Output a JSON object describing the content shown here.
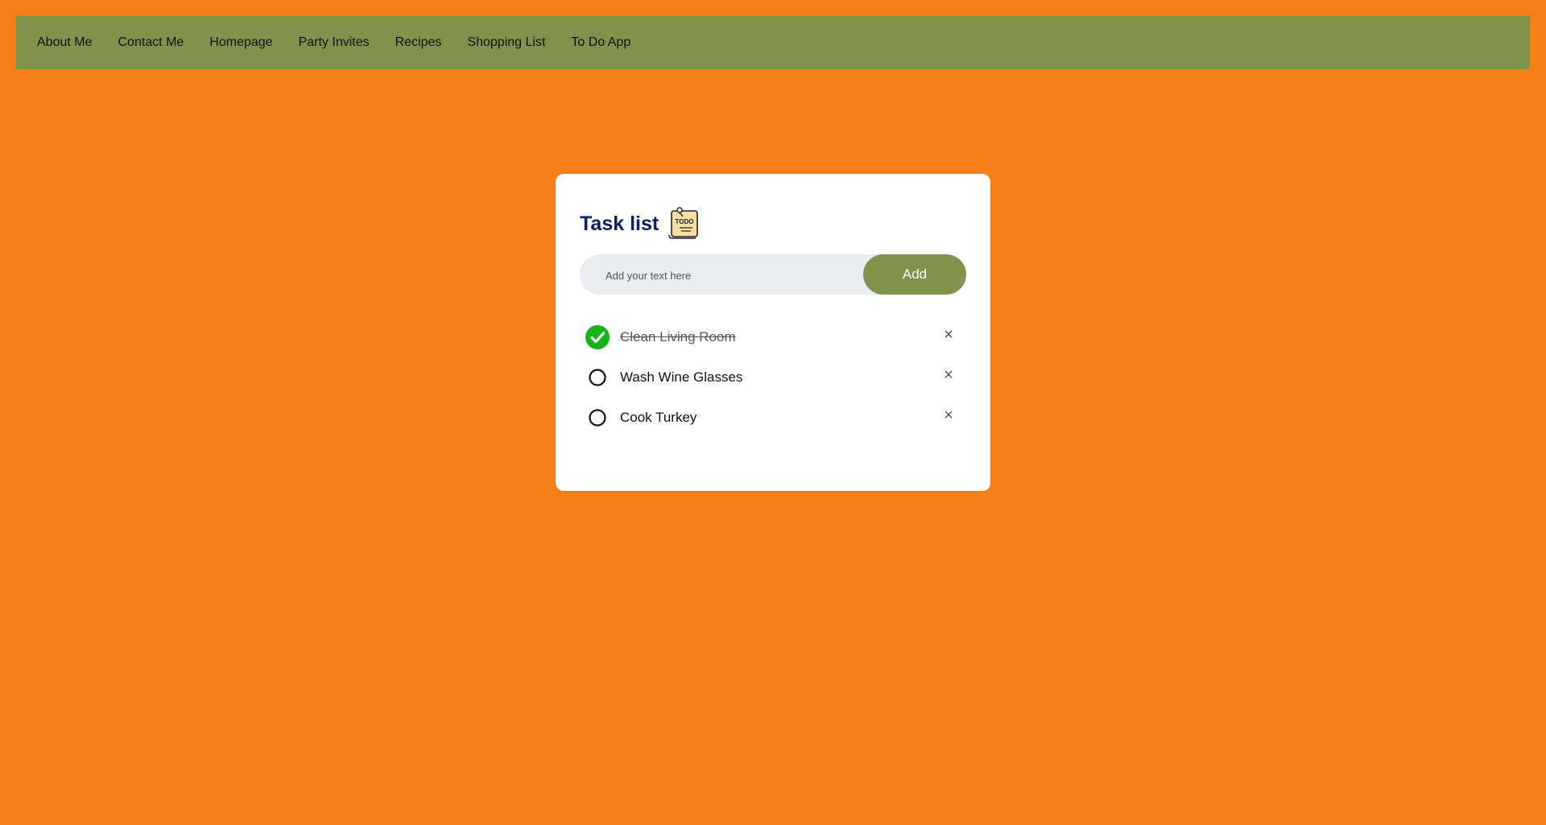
{
  "nav": {
    "items": [
      {
        "label": "About Me"
      },
      {
        "label": "Contact Me"
      },
      {
        "label": "Homepage"
      },
      {
        "label": "Party Invites"
      },
      {
        "label": "Recipes"
      },
      {
        "label": "Shopping List"
      },
      {
        "label": "To Do App"
      }
    ]
  },
  "card": {
    "title": "Task list",
    "title_icon": "todo-note-icon",
    "input": {
      "value": "",
      "placeholder": "Add your text here"
    },
    "add_label": "Add",
    "tasks": [
      {
        "label": "Clean Living Room",
        "done": true
      },
      {
        "label": "Wash Wine Glasses",
        "done": false
      },
      {
        "label": "Cook Turkey",
        "done": false
      }
    ],
    "delete_glyph": "×"
  },
  "colors": {
    "background": "#f57e17",
    "nav": "#7f934b",
    "accent": "#7f934b",
    "title": "#0b2166",
    "checked": "#14b414"
  }
}
